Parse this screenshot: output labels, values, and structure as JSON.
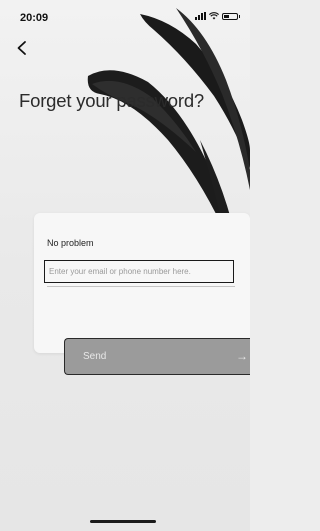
{
  "status_bar": {
    "time": "20:09",
    "icons": [
      "signal-icon",
      "wifi-icon",
      "battery-icon"
    ]
  },
  "nav": {
    "back_icon": "chevron-left-icon"
  },
  "title": "Forget your password?",
  "form": {
    "label": "No problem",
    "input_value": "",
    "input_placeholder": "Enter your email or phone number here.",
    "send_label": "Send",
    "send_icon": "arrow-right-icon"
  },
  "colors": {
    "background": "#ececec",
    "brush": "#1a1a1a",
    "card": "#f7f7f7",
    "button": "#9b9b9b",
    "button_text": "#e8e8e8"
  }
}
